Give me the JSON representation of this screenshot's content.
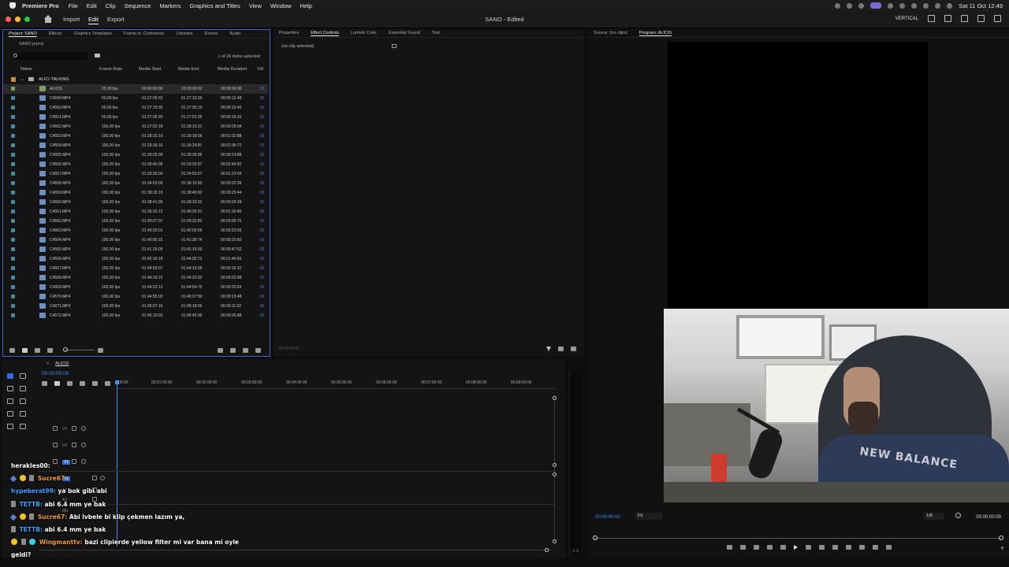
{
  "menubar": {
    "app_name": "Premiere Pro",
    "items": [
      "File",
      "Edit",
      "Clip",
      "Sequence",
      "Markers",
      "Graphics and Titles",
      "View",
      "Window",
      "Help"
    ],
    "clock": "Sat 11 Oct 12:49"
  },
  "appbar": {
    "tabs": [
      "Import",
      "Edit",
      "Export"
    ],
    "active_tab": "Edit",
    "document_title": "SANO - Edited",
    "workspace_label": "VERTICAL"
  },
  "project": {
    "tabs": [
      "Project: SANO",
      "Effects",
      "Graphics Templates",
      "Frame.io: Comments",
      "Libraries",
      "Events",
      "Audio"
    ],
    "file": "SANO.prproj",
    "item_count": "1 of 26 items selected",
    "columns": [
      "Name",
      "Frame Rate",
      "Media Start",
      "Media End",
      "Media Duration",
      "Vid"
    ],
    "bin": "ALICI-TALKING",
    "rows": [
      {
        "name": "ALICIS",
        "rate": "25,00 fps",
        "start": "00:00:00:00",
        "end": "23:00:00:01",
        "dur": "00:00:00:00",
        "vid": "01"
      },
      {
        "name": "C4549.MP4",
        "rate": "50,00 fps",
        "start": "01:27:06:32",
        "end": "01:27:19:29",
        "dur": "00:00:12:48",
        "vid": "01"
      },
      {
        "name": "C4550.MP4",
        "rate": "50,00 fps",
        "start": "01:27:19:30",
        "end": "01:27:36:19",
        "dur": "00:00:16:40",
        "vid": "01"
      },
      {
        "name": "C4551.MP4",
        "rate": "50,00 fps",
        "start": "01:27:36:20",
        "end": "01:27:52:35",
        "dur": "00:00:16:16",
        "vid": "01"
      },
      {
        "name": "C4552.MP4",
        "rate": "100,00 fps",
        "start": "01:27:52:18",
        "end": "01:28:15:21",
        "dur": "00:00:25:04",
        "vid": "01"
      },
      {
        "name": "C4553.MP4",
        "rate": "100,00 fps",
        "start": "01:28:15:19",
        "end": "01:29:18:06",
        "dur": "00:01:02:88",
        "vid": "01"
      },
      {
        "name": "C4554.MP4",
        "rate": "100,00 fps",
        "start": "01:29:18:16",
        "end": "01:30:24:87",
        "dur": "00:01:06:72",
        "vid": "01"
      },
      {
        "name": "C4555.MP4",
        "rate": "100,00 fps",
        "start": "01:30:25:09",
        "end": "01:30:39:96",
        "dur": "00:00:14:88",
        "vid": "01"
      },
      {
        "name": "C4556.MP4",
        "rate": "100,00 fps",
        "start": "01:30:40:06",
        "end": "01:33:29:97",
        "dur": "00:02:49:92",
        "vid": "01"
      },
      {
        "name": "C4557.MP4",
        "rate": "100,00 fps",
        "start": "01:33:30:04",
        "end": "01:34:53:07",
        "dur": "00:01:23:04",
        "vid": "01"
      },
      {
        "name": "C4558.MP4",
        "rate": "100,00 fps",
        "start": "01:34:53:05",
        "end": "01:38:15:60",
        "dur": "00:03:22:56",
        "vid": "01"
      },
      {
        "name": "C4559.MP4",
        "rate": "100,00 fps",
        "start": "01:38:15:19",
        "end": "01:38:40:62",
        "dur": "00:00:25:44",
        "vid": "01"
      },
      {
        "name": "C4560.MP4",
        "rate": "100,00 fps",
        "start": "01:38:41:05",
        "end": "01:39:10:32",
        "dur": "00:00:29:28",
        "vid": "01"
      },
      {
        "name": "C4561.MP4",
        "rate": "100,00 fps",
        "start": "01:39:10:12",
        "end": "01:40:26:91",
        "dur": "00:01:16:80",
        "vid": "01"
      },
      {
        "name": "C4562.MP4",
        "rate": "100,00 fps",
        "start": "01:40:27:07",
        "end": "01:40:32:82",
        "dur": "00:00:05:76",
        "vid": "01"
      },
      {
        "name": "C4563.MP4",
        "rate": "100,00 fps",
        "start": "01:40:33:01",
        "end": "01:40:55:56",
        "dur": "00:00:23:56",
        "vid": "01"
      },
      {
        "name": "C4564.MP4",
        "rate": "100,00 fps",
        "start": "01:40:55:15",
        "end": "01:41:28:74",
        "dur": "00:00:33:60",
        "vid": "01"
      },
      {
        "name": "C4565.MP4",
        "rate": "100,00 fps",
        "start": "01:41:29:05",
        "end": "01:42:16:56",
        "dur": "00:00:47:52",
        "vid": "01"
      },
      {
        "name": "C4566.MP4",
        "rate": "100,00 fps",
        "start": "01:42:16:18",
        "end": "01:44:02:73",
        "dur": "00:01:46:56",
        "vid": "01"
      },
      {
        "name": "C4567.MP4",
        "rate": "100,00 fps",
        "start": "01:44:03:07",
        "end": "01:44:19:38",
        "dur": "00:00:16:32",
        "vid": "01"
      },
      {
        "name": "C4568.MP4",
        "rate": "100,00 fps",
        "start": "01:44:19:15",
        "end": "01:44:22:02",
        "dur": "00:00:02:88",
        "vid": "01"
      },
      {
        "name": "C4569.MP4",
        "rate": "100,00 fps",
        "start": "01:44:22:12",
        "end": "01:44:54:75",
        "dur": "00:00:32:64",
        "vid": "01"
      },
      {
        "name": "C4570.MP4",
        "rate": "100,00 fps",
        "start": "01:44:55:03",
        "end": "01:45:07:50",
        "dur": "00:00:13:48",
        "vid": "01"
      },
      {
        "name": "C4571.MP4",
        "rate": "100,00 fps",
        "start": "01:45:07:15",
        "end": "01:45:18:66",
        "dur": "00:00:11:52",
        "vid": "01"
      },
      {
        "name": "C4572.MP4",
        "rate": "100,00 fps",
        "start": "01:45:19:03",
        "end": "01:45:45:90",
        "dur": "00:00:26:88",
        "vid": "01"
      }
    ]
  },
  "effects": {
    "tabs": [
      "Properties",
      "Effect Controls",
      "Lumetri Color",
      "Essential Sound",
      "Text"
    ],
    "active_tab": "Effect Controls",
    "empty_text": "(no clip selected)",
    "timecode": "00:00:00:00"
  },
  "monitor": {
    "tabs": [
      "Source: (no clips)",
      "Program: ALICIS"
    ],
    "active_tab": "Program: ALICIS",
    "time_left": "00:00:00:00",
    "time_right": "00:00:00:00",
    "fit": "Fit",
    "resolution": "1/8",
    "hoodie_text": "NEW BALANCE"
  },
  "timeline": {
    "sequence": "ALICIS",
    "timecode": "00:00:00:00",
    "ruler": [
      "00:00",
      "00:01:00:00",
      "00:02:00:00",
      "00:03:00:00",
      "00:04:00:00",
      "00:05:00:00",
      "00:06:00:00",
      "00:07:00:00",
      "00:08:00:00",
      "00:09:00:00"
    ],
    "tracks": [
      "V3",
      "V2",
      "V1",
      "A1",
      "A2",
      "A3",
      "Mix"
    ],
    "meter_label": "S S"
  },
  "chat": [
    {
      "user": "herakles00:",
      "text": "",
      "color": "#ffffff"
    },
    {
      "user": "Sucre67",
      "text": "",
      "color": "#f59a2a"
    },
    {
      "user": "hypeberat99:",
      "text": "ya bok gibi abi",
      "color": "#3aa3ff"
    },
    {
      "user": "TETTB:",
      "text": "abi 6.4 mm ye bak",
      "color": "#3aa3ff"
    },
    {
      "user": "Sucre67:",
      "text": "Abi lvbele bi klip çekmen lazım ya,",
      "color": "#f59a2a"
    },
    {
      "user": "TETTB:",
      "text": "abi 6.4 mm ye bak",
      "color": "#3aa3ff"
    },
    {
      "user": "Wingmanttv:",
      "text": "bazi clipierde yellow filter mi var bana mi oyle geldi?",
      "color": "#f59a2a"
    }
  ]
}
